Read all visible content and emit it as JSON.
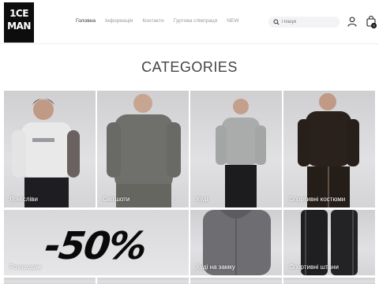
{
  "brand": {
    "logo_line1": "1CE",
    "logo_line2": "MAN"
  },
  "nav": {
    "items": [
      {
        "label": "Головна",
        "active": true
      },
      {
        "label": "Інформація",
        "active": false
      },
      {
        "label": "Контакти",
        "active": false
      },
      {
        "label": "Гуртова співпраця",
        "active": false
      },
      {
        "label": "NEW",
        "active": false
      }
    ]
  },
  "search": {
    "placeholder": "Пошук",
    "icon": "search-icon"
  },
  "cart": {
    "count": "0",
    "icon": "shopping-bag-icon"
  },
  "account": {
    "icon": "user-icon"
  },
  "section_title": "CATEGORIES",
  "categories": [
    {
      "label": "Лонгсліви"
    },
    {
      "label": "Світшоти"
    },
    {
      "label": "Худі"
    },
    {
      "label": "Спортивні костюми"
    },
    {
      "label": "Розпродаж",
      "promo_text": "-50%"
    },
    {
      "label": "Худі на замку"
    },
    {
      "label": "Спортивні штани"
    }
  ],
  "colors": {
    "text_dark": "#333333",
    "nav_muted": "#9a9a9a",
    "logo_bg": "#0d0d0d"
  }
}
